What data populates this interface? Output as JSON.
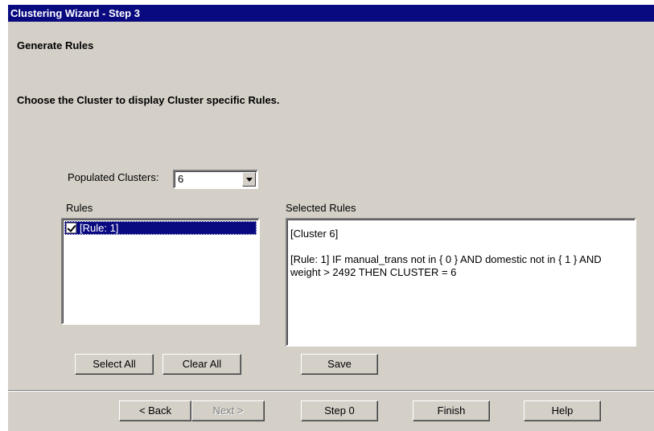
{
  "window": {
    "title": "Clustering Wizard - Step 3"
  },
  "header": {
    "section_title": "Generate Rules",
    "instruction": "Choose the Cluster to display Cluster specific Rules."
  },
  "populated_clusters": {
    "label": "Populated Clusters:",
    "value": "6"
  },
  "rules": {
    "label": "Rules",
    "items": [
      {
        "label": "[Rule: 1]",
        "checked": true
      }
    ]
  },
  "selected_rules": {
    "label": "Selected Rules",
    "line1": "[Cluster 6]",
    "line2": "[Rule: 1] IF manual_trans not in { 0 } AND domestic not in { 1 } AND",
    "line3": "weight > 2492 THEN CLUSTER = 6"
  },
  "actions": {
    "select_all": "Select All",
    "clear_all": "Clear All",
    "save": "Save"
  },
  "navigation": {
    "back": "< Back",
    "next": "Next >",
    "step0": "Step 0",
    "finish": "Finish",
    "help": "Help"
  },
  "colors": {
    "titlebar": "#0a0a80",
    "dialog_bg": "#d4d0c8",
    "selection": "#0a0a80"
  }
}
